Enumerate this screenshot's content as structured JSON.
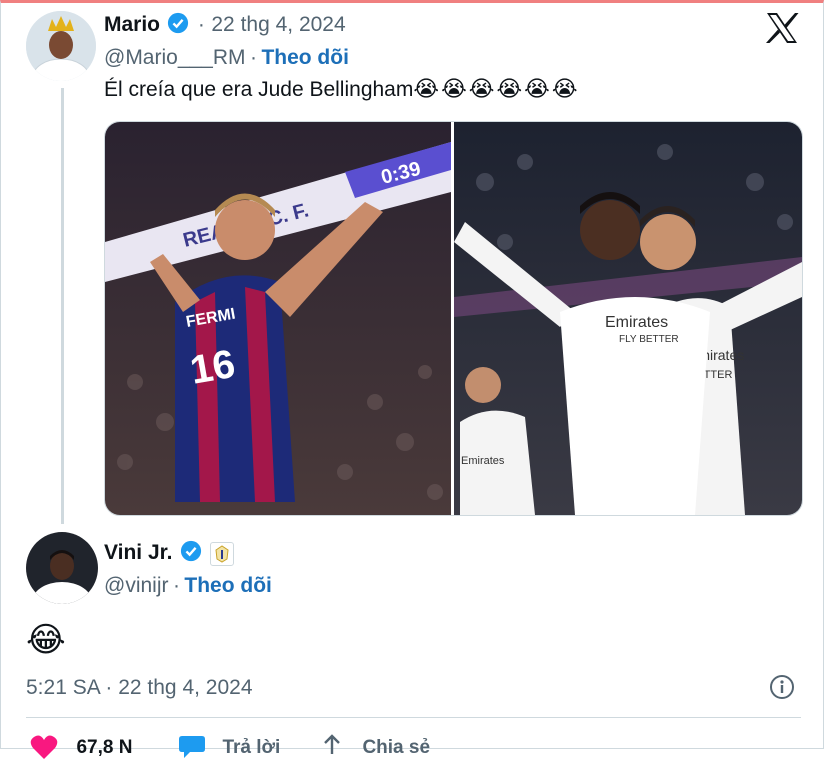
{
  "reply_tweet": {
    "author_name": "Mario",
    "handle": "@Mario___RM",
    "separator": "·",
    "date": "22 thg 4, 2024",
    "follow_label": "Theo dõi",
    "text": "Él creía que era Jude Bellingham",
    "emojis": "😭😭😭😭😭😭",
    "media_left_texts": {
      "jersey_name": "FERMI",
      "jersey_number": "16",
      "banner": "REAL M. C. F.",
      "clock": "0:39"
    },
    "media_right_texts": {
      "sponsor_front": "Emirates",
      "sponsor_front_sub": "FLY BETTER",
      "sponsor_back": "Emirates",
      "sponsor_back_sub": "BETTER",
      "sponsor_left": "Emirates"
    }
  },
  "main_tweet": {
    "author_name": "Vini Jr.",
    "handle": "@vinijr",
    "separator": "·",
    "follow_label": "Theo dõi",
    "body_emoji": "😂",
    "timestamp": "5:21 SA · 22 thg 4, 2024"
  },
  "actions": {
    "likes": "67,8 N",
    "reply_label": "Trả lời",
    "share_label": "Chia sẻ"
  },
  "colors": {
    "verified": "#1d9bf0",
    "follow": "#1d6fb8",
    "like": "#f91880",
    "border": "#cfd9de"
  },
  "icons": [
    "x-logo-icon",
    "verified-icon",
    "real-madrid-badge-icon",
    "info-icon",
    "heart-icon",
    "reply-bubble-icon",
    "share-icon"
  ]
}
